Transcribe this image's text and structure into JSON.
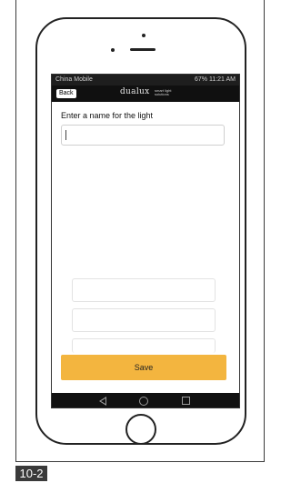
{
  "status_bar": {
    "carrier": "China Mobile",
    "indicators": "67% 11:21 AM"
  },
  "app_bar": {
    "back_label": "Back",
    "brand": "dualux",
    "tagline": "smart light solutions"
  },
  "form": {
    "prompt": "Enter a name for the light",
    "name_value": "",
    "save_label": "Save"
  },
  "nav_bar": {
    "icons": [
      "back-triangle-icon",
      "home-circle-icon",
      "recent-apps-square-icon"
    ]
  },
  "figure_label": "10-2",
  "colors": {
    "save_button": "#f3b53f",
    "status_bar": "#1e1e1e",
    "nav_bar": "#111111"
  }
}
